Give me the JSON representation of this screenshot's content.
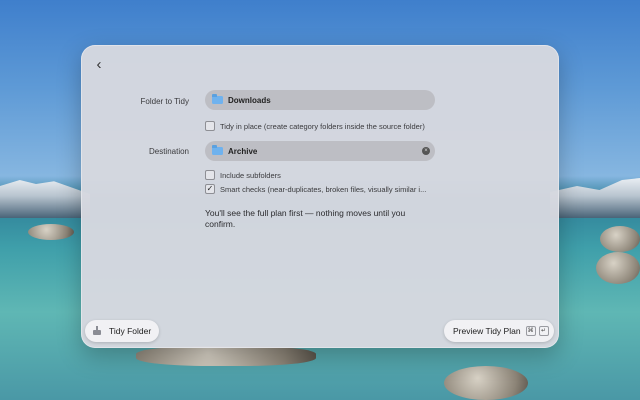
{
  "panel": {
    "back": "‹",
    "folder_label": "Folder to Tidy",
    "folder_value": "Downloads",
    "tidy_in_place": "Tidy in place (create category folders inside the source folder)",
    "destination_label": "Destination",
    "destination_value": "Archive",
    "clear_glyph": "×",
    "include_subfolders": "Include subfolders",
    "smart_checks": "Smart checks (near-duplicates, broken files, visually similar i...",
    "note": "You'll see the full plan first — nothing moves until you confirm."
  },
  "checkboxes": {
    "tidy_in_place_checked": false,
    "include_subfolders_checked": false,
    "smart_checks_checked": true
  },
  "footer": {
    "tidy_folder": "Tidy Folder",
    "preview": "Preview Tidy Plan",
    "kbd_cmd": "⌘",
    "kbd_enter": "↵"
  },
  "icons": {
    "back": "chevron-left-icon",
    "folder": "folder-icon",
    "clear": "clear-icon",
    "broom": "broom-icon",
    "command": "command-key-icon",
    "enter": "enter-key-icon"
  },
  "colors": {
    "panel_bg": "#d6d8df",
    "field_bg": "#bdbec4",
    "folder_icon": "#6fb2ee",
    "pill_bg": "#f1f1f4"
  }
}
